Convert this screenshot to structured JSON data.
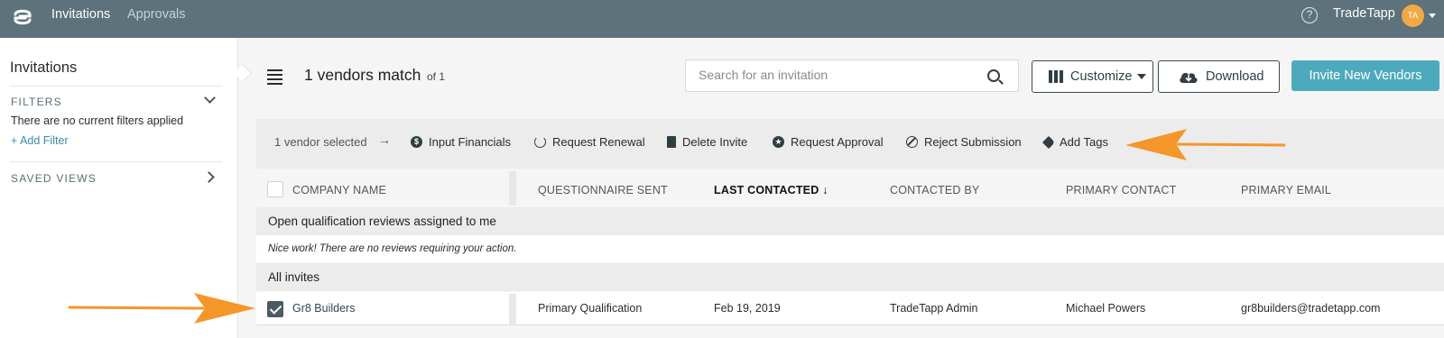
{
  "nav": {
    "tabs": [
      {
        "label": "Invitations",
        "active": true
      },
      {
        "label": "Approvals",
        "active": false
      }
    ],
    "help_icon": "question-circle-icon",
    "brand": "TradeTapp",
    "avatar_initials": "TA"
  },
  "sidebar": {
    "title": "Invitations",
    "filters_heading": "FILTERS",
    "no_filters_text": "There are no current filters applied",
    "add_filter_label": "+ Add Filter",
    "saved_views_heading": "SAVED VIEWS"
  },
  "header": {
    "match_count": "1 vendors match",
    "match_of": "of 1",
    "search": {
      "placeholder": "Search for an invitation",
      "value": ""
    },
    "customize_label": "Customize",
    "download_label": "Download",
    "invite_label": "Invite New Vendors"
  },
  "action_bar": {
    "selected_text": "1 vendor selected",
    "actions": [
      {
        "label": "Input Financials",
        "icon": "dollar-icon"
      },
      {
        "label": "Request Renewal",
        "icon": "renew-icon"
      },
      {
        "label": "Delete Invite",
        "icon": "trash-icon"
      },
      {
        "label": "Request Approval",
        "icon": "star-icon"
      },
      {
        "label": "Reject Submission",
        "icon": "ban-icon"
      },
      {
        "label": "Add Tags",
        "icon": "tag-icon"
      }
    ]
  },
  "table": {
    "columns": [
      "COMPANY NAME",
      "QUESTIONNAIRE SENT",
      "LAST CONTACTED ↓",
      "CONTACTED BY",
      "PRIMARY CONTACT",
      "PRIMARY EMAIL"
    ],
    "sorted_column": "LAST CONTACTED",
    "section_reviews": "Open qualification reviews assigned to me",
    "no_reviews_text": "Nice work! There are no reviews requiring your action.",
    "section_all": "All invites",
    "rows": [
      {
        "checked": true,
        "company": "Gr8 Builders",
        "questionnaire": "Primary Qualification",
        "last_contacted": "Feb 19, 2019",
        "contacted_by": "TradeTapp Admin",
        "primary_contact": "Michael Powers",
        "primary_email": "gr8builders@tradetapp.com"
      }
    ]
  },
  "colors": {
    "nav_bg": "#5d727a",
    "accent": "#4daabc",
    "annotation": "#f5962a",
    "avatar": "#f0a945"
  }
}
